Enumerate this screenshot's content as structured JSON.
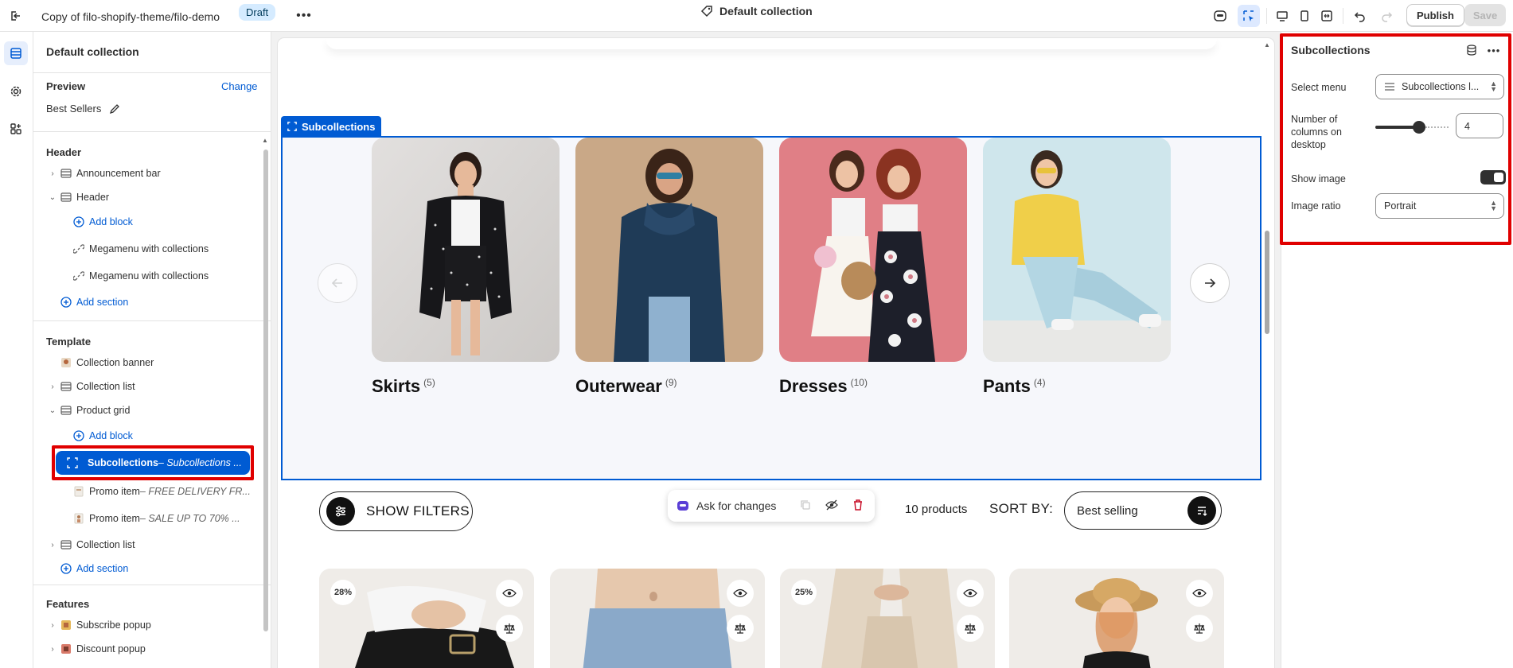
{
  "topbar": {
    "title": "Copy of filo-shopify-theme/filo-demo",
    "badge": "Draft",
    "center_title": "Default collection",
    "publish_label": "Publish",
    "save_label": "Save"
  },
  "sidebar": {
    "title": "Default collection",
    "preview_label": "Preview",
    "change_label": "Change",
    "preview_value": "Best Sellers",
    "header_group": "Header",
    "template_group": "Template",
    "features_group": "Features",
    "header_items": [
      {
        "label": "Announcement bar"
      },
      {
        "label": "Header"
      },
      {
        "label": "Add block"
      },
      {
        "label": "Megamenu with collections"
      },
      {
        "label": "Megamenu with collections"
      },
      {
        "label": "Add section"
      }
    ],
    "template_items": [
      {
        "label": "Collection banner"
      },
      {
        "label": "Collection list"
      },
      {
        "label": "Product grid"
      },
      {
        "label": "Add block"
      },
      {
        "label": "Subcollections",
        "sub": " – Subcollections ..."
      },
      {
        "label": "Promo item",
        "sub": " – FREE DELIVERY FR..."
      },
      {
        "label": "Promo item",
        "sub": " – SALE UP TO 70% ..."
      },
      {
        "label": "Collection list"
      },
      {
        "label": "Add section"
      }
    ],
    "feature_items": [
      {
        "label": "Subscribe popup"
      },
      {
        "label": "Discount popup"
      }
    ]
  },
  "canvas": {
    "section_label": "Subcollections",
    "cards": [
      {
        "name": "Skirts",
        "count": "(5)"
      },
      {
        "name": "Outerwear",
        "count": "(9)"
      },
      {
        "name": "Dresses",
        "count": "(10)"
      },
      {
        "name": "Pants",
        "count": "(4)"
      }
    ],
    "show_filters": "SHOW FILTERS",
    "ask_for_changes": "Ask for changes",
    "product_count": "10 products",
    "sort_by": "SORT BY:",
    "sort_value": "Best selling",
    "product_badges": [
      "28%",
      "",
      "25%",
      ""
    ]
  },
  "right_panel": {
    "title": "Subcollections",
    "select_menu_label": "Select menu",
    "select_menu_value": "Subcollections l...",
    "columns_label": "Number of columns on desktop",
    "columns_value": "4",
    "columns_slider_fraction": 0.6,
    "show_image_label": "Show image",
    "show_image_on": true,
    "image_ratio_label": "Image ratio",
    "image_ratio_value": "Portrait"
  }
}
